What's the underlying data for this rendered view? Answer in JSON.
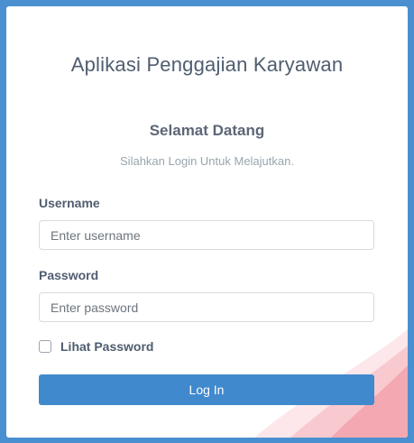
{
  "app": {
    "title": "Aplikasi Penggajian Karyawan"
  },
  "login": {
    "welcome": "Selamat Datang",
    "subtitle": "Silahkan Login Untuk Melajutkan.",
    "username_label": "Username",
    "username_placeholder": "Enter username",
    "username_value": "",
    "password_label": "Password",
    "password_placeholder": "Enter password",
    "password_value": "",
    "show_password_label": "Lihat Password",
    "show_password_checked": false,
    "submit_label": "Log In"
  },
  "colors": {
    "background": "#4a8fd0",
    "button": "#4189cd",
    "title_text": "#4f5d6f",
    "wave": "#f5b7bf"
  }
}
